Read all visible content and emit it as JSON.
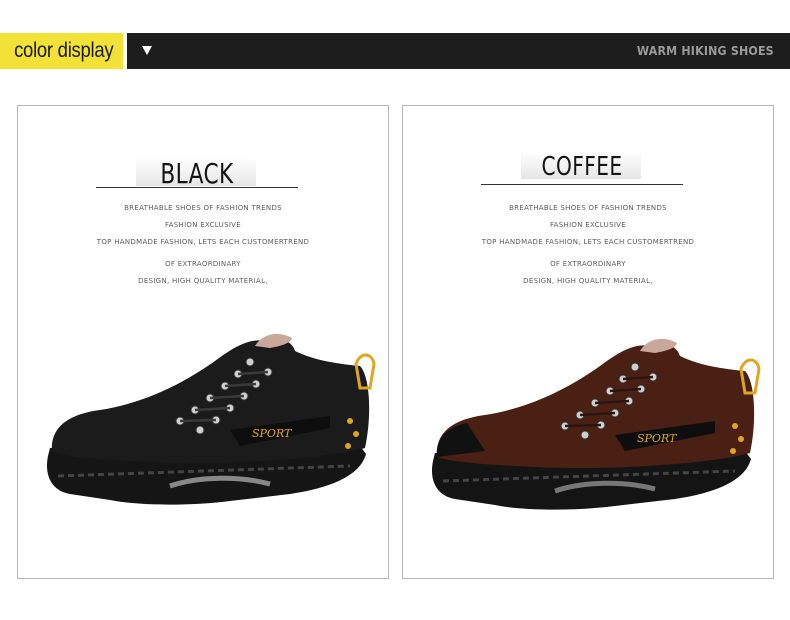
{
  "header": {
    "tag_label": "color display",
    "right_label": "WARM HIKING SHOES",
    "arrow_icon": "triangle-down"
  },
  "products": [
    {
      "color_name": "BLACK",
      "description": [
        "BREATHABLE SHOES OF FASHION TRENDS",
        "FASHION EXCLUSIVE",
        "TOP HANDMADE FASHION, LETS EACH CUSTOMERTREND",
        "OF EXTRAORDINARY",
        "DESIGN, HIGH QUALITY MATERIAL,"
      ],
      "badge": "SPORT",
      "upper_color": "#1b1b1b"
    },
    {
      "color_name": "COFFEE",
      "description": [
        "BREATHABLE SHOES OF FASHION TRENDS",
        "FASHION EXCLUSIVE",
        "TOP HANDMADE FASHION, LETS EACH CUSTOMERTREND",
        "OF EXTRAORDINARY",
        "DESIGN, HIGH QUALITY MATERIAL,"
      ],
      "badge": "SPORT",
      "upper_color": "#4a1f14"
    }
  ],
  "colors": {
    "tag_yellow": "#f2e237",
    "bar_dark": "#1d1d1d",
    "accent_yellow": "#e0a622"
  }
}
